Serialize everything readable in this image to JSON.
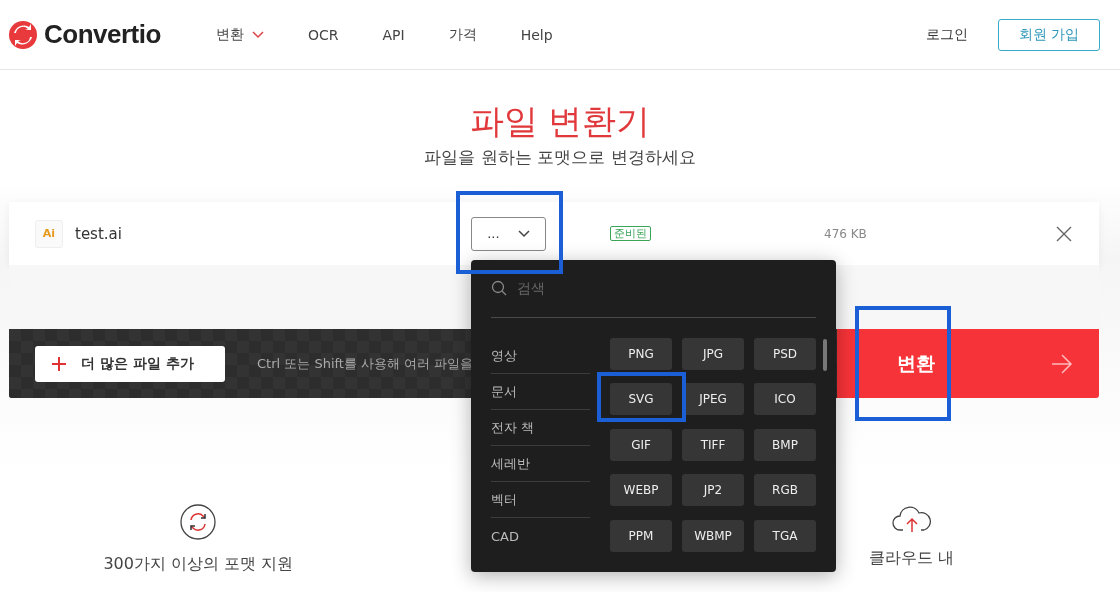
{
  "header": {
    "logo": "Convertio",
    "nav": [
      {
        "label": "변환",
        "dropdown": true
      },
      {
        "label": "OCR",
        "dropdown": false
      },
      {
        "label": "API",
        "dropdown": false
      },
      {
        "label": "가격",
        "dropdown": false
      },
      {
        "label": "Help",
        "dropdown": false
      }
    ],
    "login": "로그인",
    "signup": "회원 가입"
  },
  "hero": {
    "title": "파일 변환기",
    "subtitle": "파일을 원하는 포맷으로 변경하세요"
  },
  "file": {
    "badge": "Ai",
    "name": "test.ai",
    "format": "...",
    "status": "준비된",
    "size": "476 KB"
  },
  "actions": {
    "add": "더 많은 파일 추가",
    "hint": "Ctrl 또는 Shift를 사용해 여러 파일을",
    "convert": "변환"
  },
  "menu": {
    "placeholder": "검색",
    "categories": [
      "영상",
      "문서",
      "전자 책",
      "세레반",
      "벡터",
      "CAD"
    ],
    "formats": [
      "PNG",
      "JPG",
      "PSD",
      "SVG",
      "JPEG",
      "ICO",
      "GIF",
      "TIFF",
      "BMP",
      "WEBP",
      "JP2",
      "RGB",
      "PPM",
      "WBMP",
      "TGA"
    ]
  },
  "features": [
    {
      "kind": "sync",
      "label": "300가지 이상의 포맷 지원"
    },
    {
      "kind": "hidden"
    },
    {
      "kind": "cloud",
      "label": "클라우드 내"
    }
  ]
}
